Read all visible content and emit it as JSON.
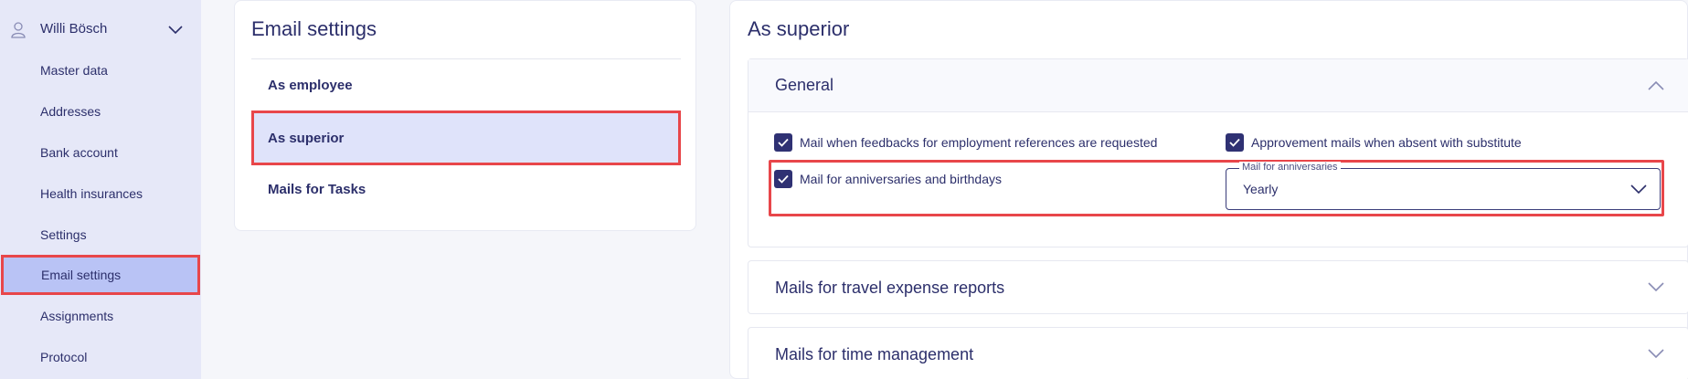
{
  "sidebar": {
    "user_name": "Willi Bösch",
    "items": [
      {
        "label": "Master data"
      },
      {
        "label": "Addresses"
      },
      {
        "label": "Bank account"
      },
      {
        "label": "Health insurances"
      },
      {
        "label": "Settings"
      },
      {
        "label": "Email settings",
        "active": true
      },
      {
        "label": "Assignments"
      },
      {
        "label": "Protocol"
      }
    ]
  },
  "email_settings": {
    "title": "Email settings",
    "items": [
      {
        "label": "As employee"
      },
      {
        "label": "As superior",
        "active": true
      },
      {
        "label": "Mails for Tasks"
      }
    ]
  },
  "detail": {
    "title": "As superior",
    "sections": [
      {
        "title": "General",
        "expanded": true
      },
      {
        "title": "Mails for travel expense reports",
        "expanded": false
      },
      {
        "title": "Mails for time management",
        "expanded": false
      }
    ],
    "general": {
      "checkbox_feedbacks": {
        "label": "Mail when feedbacks for employment references are requested",
        "checked": true
      },
      "checkbox_approvement": {
        "label": "Approvement mails when absent with substitute",
        "checked": true
      },
      "checkbox_anniversaries": {
        "label": "Mail for anniversaries and birthdays",
        "checked": true
      },
      "anniversary_select": {
        "label": "Mail for anniversaries",
        "value": "Yearly"
      }
    }
  },
  "colors": {
    "accent": "#2f3173",
    "sidebar_bg": "#e6e8f8",
    "sidebar_active": "#b9c3f5",
    "menu_active": "#dfe3fa",
    "highlight": "#e8464a"
  }
}
